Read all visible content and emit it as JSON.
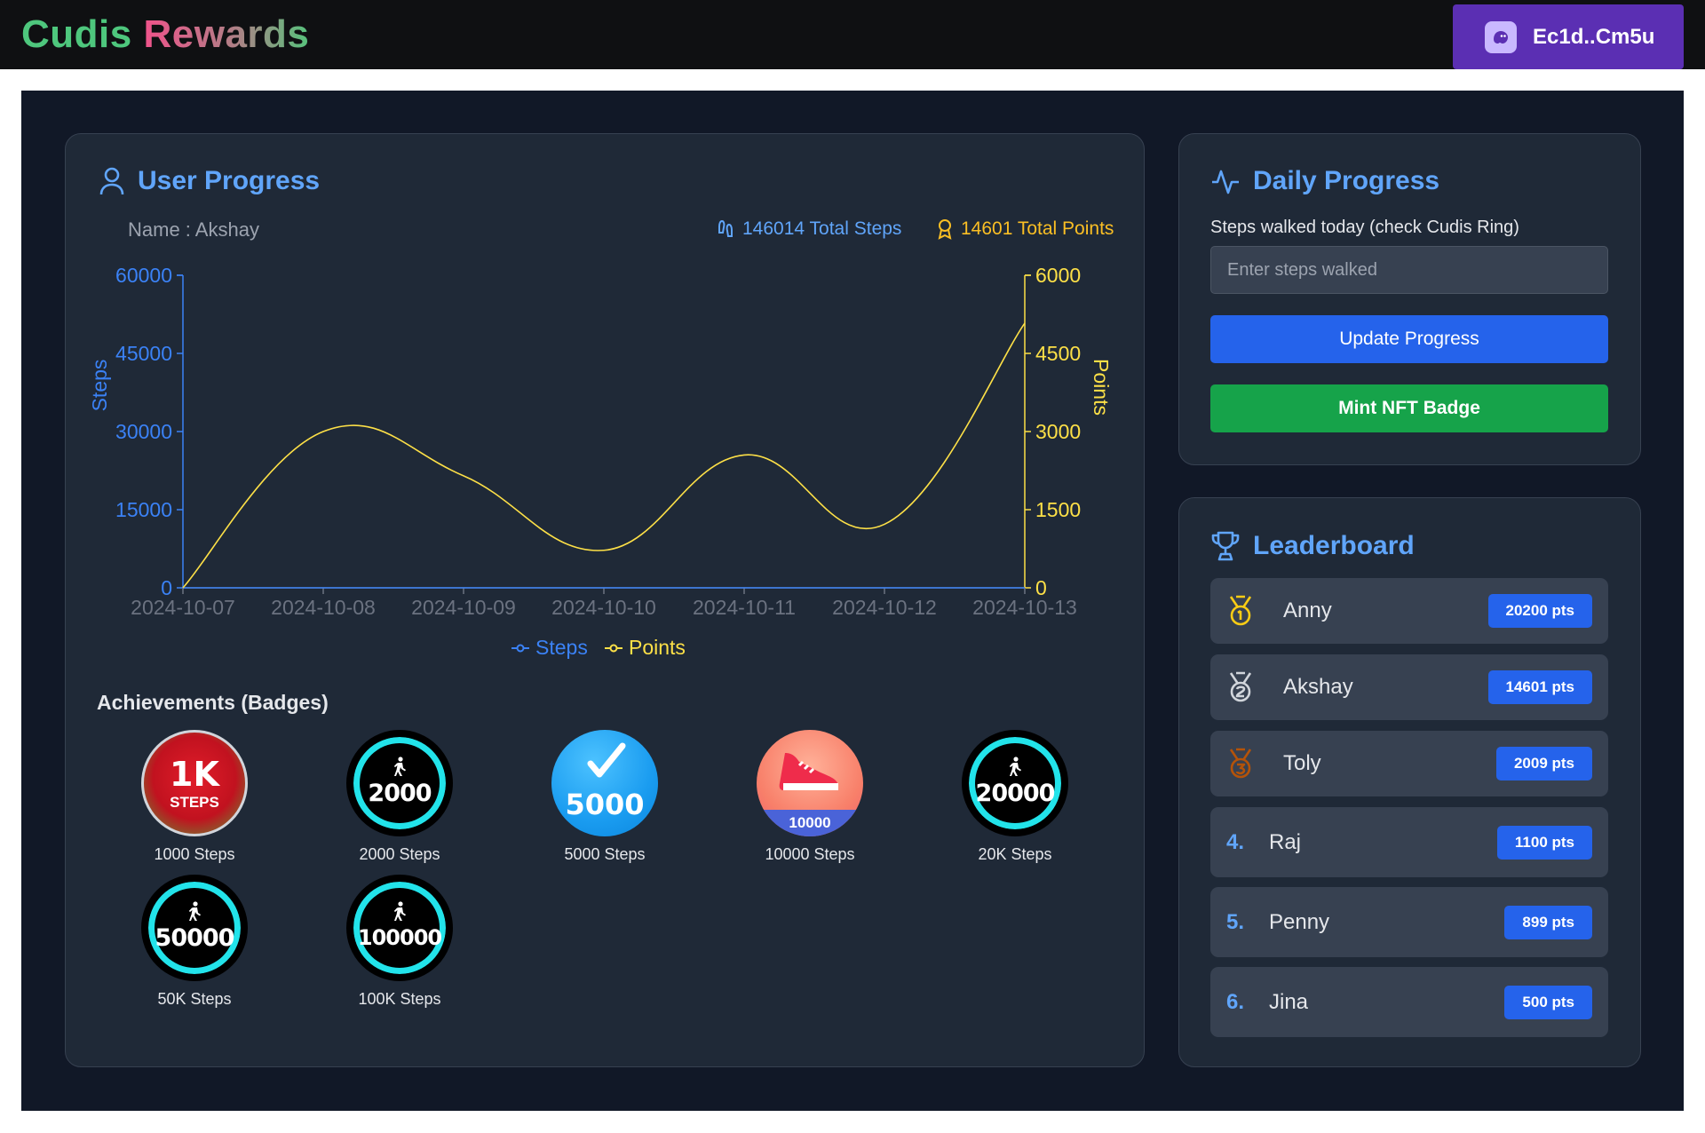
{
  "brand": {
    "word1": "Cudis",
    "word2": "Rewards"
  },
  "wallet": {
    "label": "Ec1d..Cm5u",
    "icon": "ghost-icon"
  },
  "user_progress": {
    "title": "User Progress",
    "name_label": "Name : Akshay",
    "total_steps": "146014 Total Steps",
    "total_points": "14601 Total Points"
  },
  "chart_data": {
    "type": "line",
    "x": [
      "2024-10-07",
      "2024-10-08",
      "2024-10-09",
      "2024-10-10",
      "2024-10-11",
      "2024-10-12",
      "2024-10-13"
    ],
    "series": [
      {
        "name": "Steps",
        "axis": "left",
        "color": "#3b82f6",
        "values": [
          0,
          0,
          0,
          0,
          0,
          0,
          0
        ]
      },
      {
        "name": "Points",
        "axis": "right",
        "color": "#fde047",
        "values": [
          0,
          3000,
          2150,
          720,
          2550,
          1220,
          5080
        ]
      }
    ],
    "ylabel": "Steps",
    "y2label": "Points",
    "ylim": [
      0,
      60000
    ],
    "y2lim": [
      0,
      6000
    ],
    "yticks": [
      "0",
      "15000",
      "30000",
      "45000",
      "60000"
    ],
    "y2ticks": [
      "0",
      "1500",
      "3000",
      "4500",
      "6000"
    ],
    "grid": false,
    "legend": "bottom"
  },
  "achievements": {
    "title": "Achievements (Badges)",
    "badges": [
      {
        "caption": "1000 Steps",
        "big": "1K",
        "small": "STEPS"
      },
      {
        "caption": "2000 Steps",
        "big": "2000"
      },
      {
        "caption": "5000 Steps",
        "big": "5000"
      },
      {
        "caption": "10000 Steps",
        "big": "10000"
      },
      {
        "caption": "20K Steps",
        "big": "20000"
      },
      {
        "caption": "50K Steps",
        "big": "50000"
      },
      {
        "caption": "100K Steps",
        "big": "100000"
      }
    ]
  },
  "daily_progress": {
    "title": "Daily Progress",
    "label": "Steps walked today (check Cudis Ring)",
    "placeholder": "Enter steps walked",
    "update_button": "Update Progress",
    "mint_button": "Mint NFT Badge"
  },
  "leaderboard": {
    "title": "Leaderboard",
    "entries": [
      {
        "medal": "gold",
        "name": "Anny",
        "points": "20200 pts"
      },
      {
        "medal": "silver",
        "name": "Akshay",
        "points": "14601 pts"
      },
      {
        "medal": "bronze",
        "name": "Toly",
        "points": "2009 pts"
      },
      {
        "rank": "4.",
        "name": "Raj",
        "points": "1100 pts"
      },
      {
        "rank": "5.",
        "name": "Penny",
        "points": "899 pts"
      },
      {
        "rank": "6.",
        "name": "Jina",
        "points": "500 pts"
      }
    ]
  },
  "colors": {
    "page_bg": "#111827",
    "card_bg": "#1f2937",
    "accent_blue": "#60a5fa",
    "accent_yellow": "#fde047",
    "button_blue": "#2563eb",
    "button_green": "#16a34a",
    "wallet_purple": "#5b2fb3"
  }
}
